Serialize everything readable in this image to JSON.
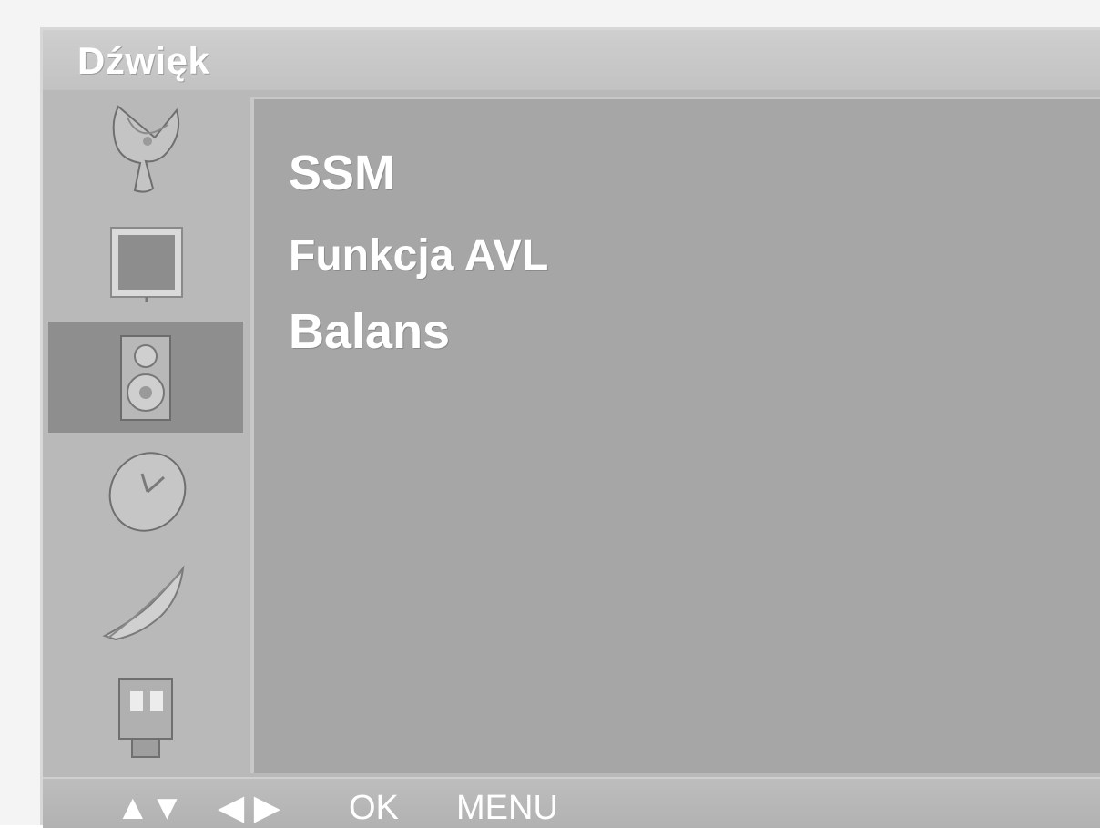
{
  "title": "Dźwięk",
  "menu": {
    "items": [
      {
        "label": "SSM"
      },
      {
        "label": "Funkcja AVL"
      },
      {
        "label": "Balans"
      }
    ]
  },
  "sidebar": {
    "items": [
      {
        "icon": "satellite-dish-icon"
      },
      {
        "icon": "picture-screen-icon"
      },
      {
        "icon": "speaker-icon",
        "selected": true
      },
      {
        "icon": "clock-icon"
      },
      {
        "icon": "feather-icon"
      },
      {
        "icon": "input-connector-icon"
      }
    ]
  },
  "footer": {
    "updown": "▲▼",
    "leftright": "◀ ▶",
    "ok": "OK",
    "menu": "MENU"
  }
}
